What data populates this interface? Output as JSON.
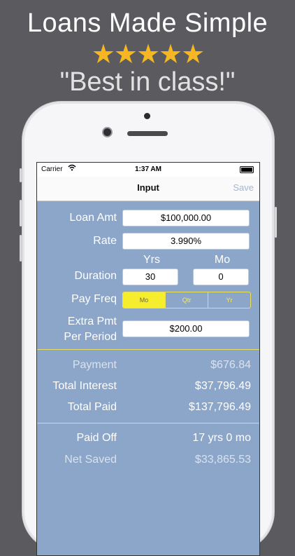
{
  "promo": {
    "headline": "Loans Made Simple",
    "stars": "★★★★★",
    "quote": "\"Best in class!\""
  },
  "colors": {
    "background": "#5a5a5f",
    "star": "#f7b722",
    "form_bg": "#8ca6c9",
    "segment_selected": "#f6ee2c",
    "divider": "#e4de6c",
    "save_link": "#9fb7d6"
  },
  "status_bar": {
    "carrier": "Carrier",
    "wifi_icon": "wifi-icon",
    "time": "1:37 AM",
    "battery_icon": "battery-icon"
  },
  "nav": {
    "title": "Input",
    "save_label": "Save"
  },
  "form": {
    "loan_amt_label": "Loan Amt",
    "loan_amt_value": "$100,000.00",
    "rate_label": "Rate",
    "rate_value": "3.990%",
    "yrs_header": "Yrs",
    "mo_header": "Mo",
    "duration_label": "Duration",
    "duration_yrs": "30",
    "duration_mo": "0",
    "pay_freq_label": "Pay Freq",
    "pay_freq_options": [
      "Mo",
      "Qtr",
      "Yr"
    ],
    "pay_freq_selected": "Mo",
    "extra_label_line1": "Extra Pmt",
    "extra_label_line2": "Per Period",
    "extra_value": "$200.00"
  },
  "results": {
    "payment_label": "Payment",
    "payment_value": "$676.84",
    "total_interest_label": "Total Interest",
    "total_interest_value": "$37,796.49",
    "total_paid_label": "Total Paid",
    "total_paid_value": "$137,796.49",
    "paid_off_label": "Paid Off",
    "paid_off_value": "17 yrs 0 mo",
    "net_saved_label": "Net Saved",
    "net_saved_value": "$33,865.53"
  }
}
